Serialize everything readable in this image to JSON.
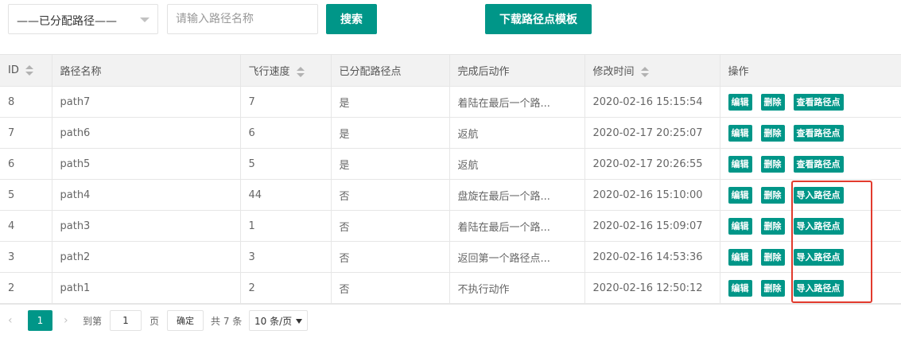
{
  "filter": {
    "selected": "——已分配路径——",
    "search_placeholder": "请输入路径名称",
    "search_label": "搜索",
    "download_label": "下载路径点模板"
  },
  "table": {
    "headers": [
      "ID",
      "路径名称",
      "飞行速度",
      "已分配路径点",
      "完成后动作",
      "修改时间",
      "操作"
    ],
    "rows": [
      {
        "id": "8",
        "name": "path7",
        "speed": "7",
        "assigned": "是",
        "action": "着陆在最后一个路...",
        "time": "2020-02-16 15:15:54",
        "edit": "编辑",
        "del": "删除",
        "third": "查看路径点"
      },
      {
        "id": "7",
        "name": "path6",
        "speed": "6",
        "assigned": "是",
        "action": "返航",
        "time": "2020-02-17 20:25:07",
        "edit": "编辑",
        "del": "删除",
        "third": "查看路径点"
      },
      {
        "id": "6",
        "name": "path5",
        "speed": "5",
        "assigned": "是",
        "action": "返航",
        "time": "2020-02-17 20:26:55",
        "edit": "编辑",
        "del": "删除",
        "third": "查看路径点"
      },
      {
        "id": "5",
        "name": "path4",
        "speed": "44",
        "assigned": "否",
        "action": "盘旋在最后一个路...",
        "time": "2020-02-16 15:10:00",
        "edit": "编辑",
        "del": "删除",
        "third": "导入路径点"
      },
      {
        "id": "4",
        "name": "path3",
        "speed": "1",
        "assigned": "否",
        "action": "着陆在最后一个路...",
        "time": "2020-02-16 15:09:07",
        "edit": "编辑",
        "del": "删除",
        "third": "导入路径点"
      },
      {
        "id": "3",
        "name": "path2",
        "speed": "3",
        "assigned": "否",
        "action": "返回第一个路径点...",
        "time": "2020-02-16 14:53:36",
        "edit": "编辑",
        "del": "删除",
        "third": "导入路径点"
      },
      {
        "id": "2",
        "name": "path1",
        "speed": "2",
        "assigned": "否",
        "action": "不执行动作",
        "time": "2020-02-16 12:50:12",
        "edit": "编辑",
        "del": "删除",
        "third": "导入路径点"
      }
    ]
  },
  "pager": {
    "prev": "‹",
    "current": "1",
    "next": "›",
    "goto": "到第",
    "page_value": "1",
    "page_unit": "页",
    "confirm": "确定",
    "total": "共 7 条",
    "size": "10 条/页"
  },
  "colors": {
    "accent": "#009688",
    "highlight": "#e23b2e"
  }
}
